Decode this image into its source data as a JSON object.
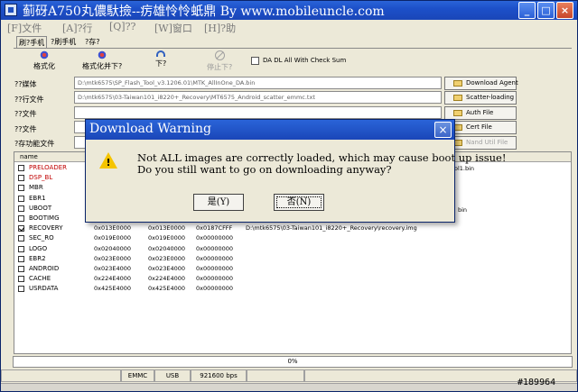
{
  "window": {
    "title": "蓟砑A750丸儂馱撿--疠雄怜怜蚔鼎  By  www.mobileuncle.com",
    "minimize_label": "_",
    "maximize_label": "□",
    "close_label": "×"
  },
  "menu": [
    "[F]文件",
    "[A]?行",
    "[Q]??",
    "[W]窗口",
    "[H]?助"
  ],
  "tabs": [
    "刷?手机",
    "?刷手机",
    "?存?"
  ],
  "toolbar": {
    "format": "格式化",
    "format_download": "格式化并下?",
    "download": "下?",
    "stop": "停止下?",
    "checkbox_label": "DA DL All With Check Sum"
  },
  "file_rows": [
    {
      "label": "??媒体",
      "value": "D:\\mtk6575\\SP_Flash_Tool_v3.1206.01\\MTK_AllInOne_DA.bin"
    },
    {
      "label": "??行文件",
      "value": "D:\\mtk6575\\03-Taiwan101_i8220+_Recovery\\MT6575_Android_scatter_emmc.txt"
    },
    {
      "label": "??文件",
      "value": ""
    },
    {
      "label": "??文件",
      "value": ""
    },
    {
      "label": "?存功能文件",
      "value": ""
    }
  ],
  "side_buttons": [
    "Download Agent",
    "Scatter-loading",
    "Auth File",
    "Cert File",
    "Nand Util File"
  ],
  "list": {
    "header": "name",
    "rows": [
      {
        "name": "PRELOADER",
        "checked": false,
        "red": true,
        "c1": "",
        "c2": "",
        "c3": "",
        "c4": ""
      },
      {
        "name": "DSP_BL",
        "checked": false,
        "red": true,
        "c1": "",
        "c2": "",
        "c3": "",
        "c4": ""
      },
      {
        "name": "MBR",
        "checked": false,
        "red": false,
        "c1": "",
        "c2": "",
        "c3": "",
        "c4": ""
      },
      {
        "name": "EBR1",
        "checked": false,
        "red": false,
        "c1": "",
        "c2": "",
        "c3": "",
        "c4": ""
      },
      {
        "name": "UBOOT",
        "checked": false,
        "red": false,
        "c1": "",
        "c2": "",
        "c3": "",
        "c4": ""
      },
      {
        "name": "BOOTIMG",
        "checked": false,
        "red": false,
        "c1": "",
        "c2": "",
        "c3": "",
        "c4": ""
      },
      {
        "name": "RECOVERY",
        "checked": true,
        "red": false,
        "c1": "0x013E0000",
        "c2": "0x013E0000",
        "c3": "0x0187CFFF",
        "c4": "D:\\mtk6575\\03-Taiwan101_i8220+_Recovery\\recovery.img"
      },
      {
        "name": "SEC_RO",
        "checked": false,
        "red": false,
        "c1": "0x019E0000",
        "c2": "0x019E0000",
        "c3": "0x00000000",
        "c4": ""
      },
      {
        "name": "LOGO",
        "checked": false,
        "red": false,
        "c1": "0x02040000",
        "c2": "0x02040000",
        "c3": "0x00000000",
        "c4": ""
      },
      {
        "name": "EBR2",
        "checked": false,
        "red": false,
        "c1": "0x023E0000",
        "c2": "0x023E0000",
        "c3": "0x00000000",
        "c4": ""
      },
      {
        "name": "ANDROID",
        "checked": false,
        "red": false,
        "c1": "0x023E4000",
        "c2": "0x023E4000",
        "c3": "0x00000000",
        "c4": ""
      },
      {
        "name": "CACHE",
        "checked": false,
        "red": false,
        "c1": "0x224E4000",
        "c2": "0x224E4000",
        "c3": "0x00000000",
        "c4": ""
      },
      {
        "name": "USRDATA",
        "checked": false,
        "red": false,
        "c1": "0x425E4000",
        "c2": "0x425E4000",
        "c3": "0x00000000",
        "c4": ""
      }
    ],
    "peek_preloader": "ol1.bin",
    "peek_uboot": "bin"
  },
  "progress": {
    "label": "0%",
    "fraction": 0
  },
  "status": [
    "",
    "EMMC",
    "USB",
    "921600 bps",
    "",
    ""
  ],
  "dialog": {
    "title": "Download Warning",
    "close_label": "×",
    "message_line1": "Not ALL images are correctly loaded, which may cause boot up issue!",
    "message_line2": "Do you still want to go on downloading anyway?",
    "yes_label": "是(Y)",
    "no_label": "否(N)",
    "icon_mark": "!"
  },
  "watermark": "#189964",
  "colors": {
    "titlebar": "#1d50c9",
    "red_item": "#c00000",
    "warning": "#f5c400"
  }
}
